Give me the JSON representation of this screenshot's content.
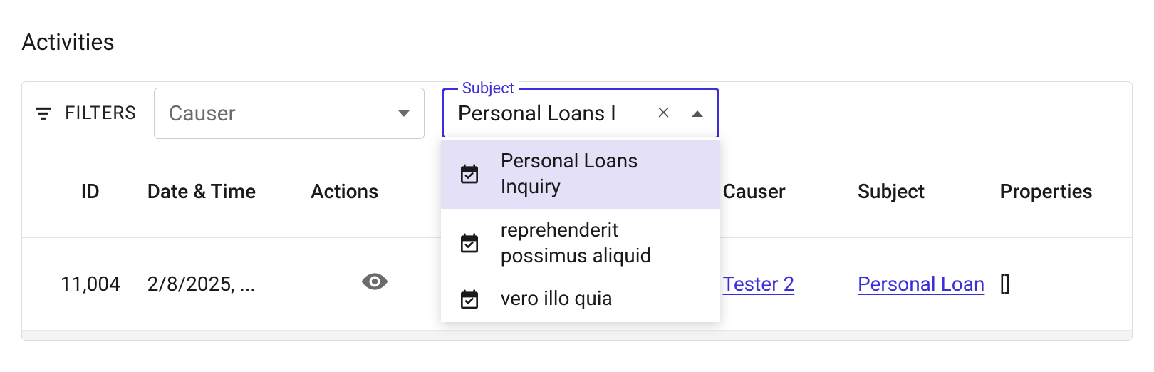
{
  "page_title": "Activities",
  "filters": {
    "label": "FILTERS",
    "causer": {
      "placeholder": "Causer"
    },
    "subject": {
      "legend": "Subject",
      "value": "Personal Loans I",
      "options": [
        {
          "label": "Personal Loans Inquiry",
          "selected": true
        },
        {
          "label": "reprehenderit possimus aliquid",
          "selected": false
        },
        {
          "label": "vero illo quia",
          "selected": false
        }
      ]
    }
  },
  "table": {
    "headers": {
      "id": "ID",
      "datetime": "Date & Time",
      "actions": "Actions",
      "causer": "Causer",
      "subject": "Subject",
      "properties": "Properties"
    },
    "rows": [
      {
        "id": "11,004",
        "datetime": "2/8/2025, ...",
        "causer": "Tester 2",
        "subject": "Personal Loan",
        "properties": "[]"
      }
    ]
  }
}
